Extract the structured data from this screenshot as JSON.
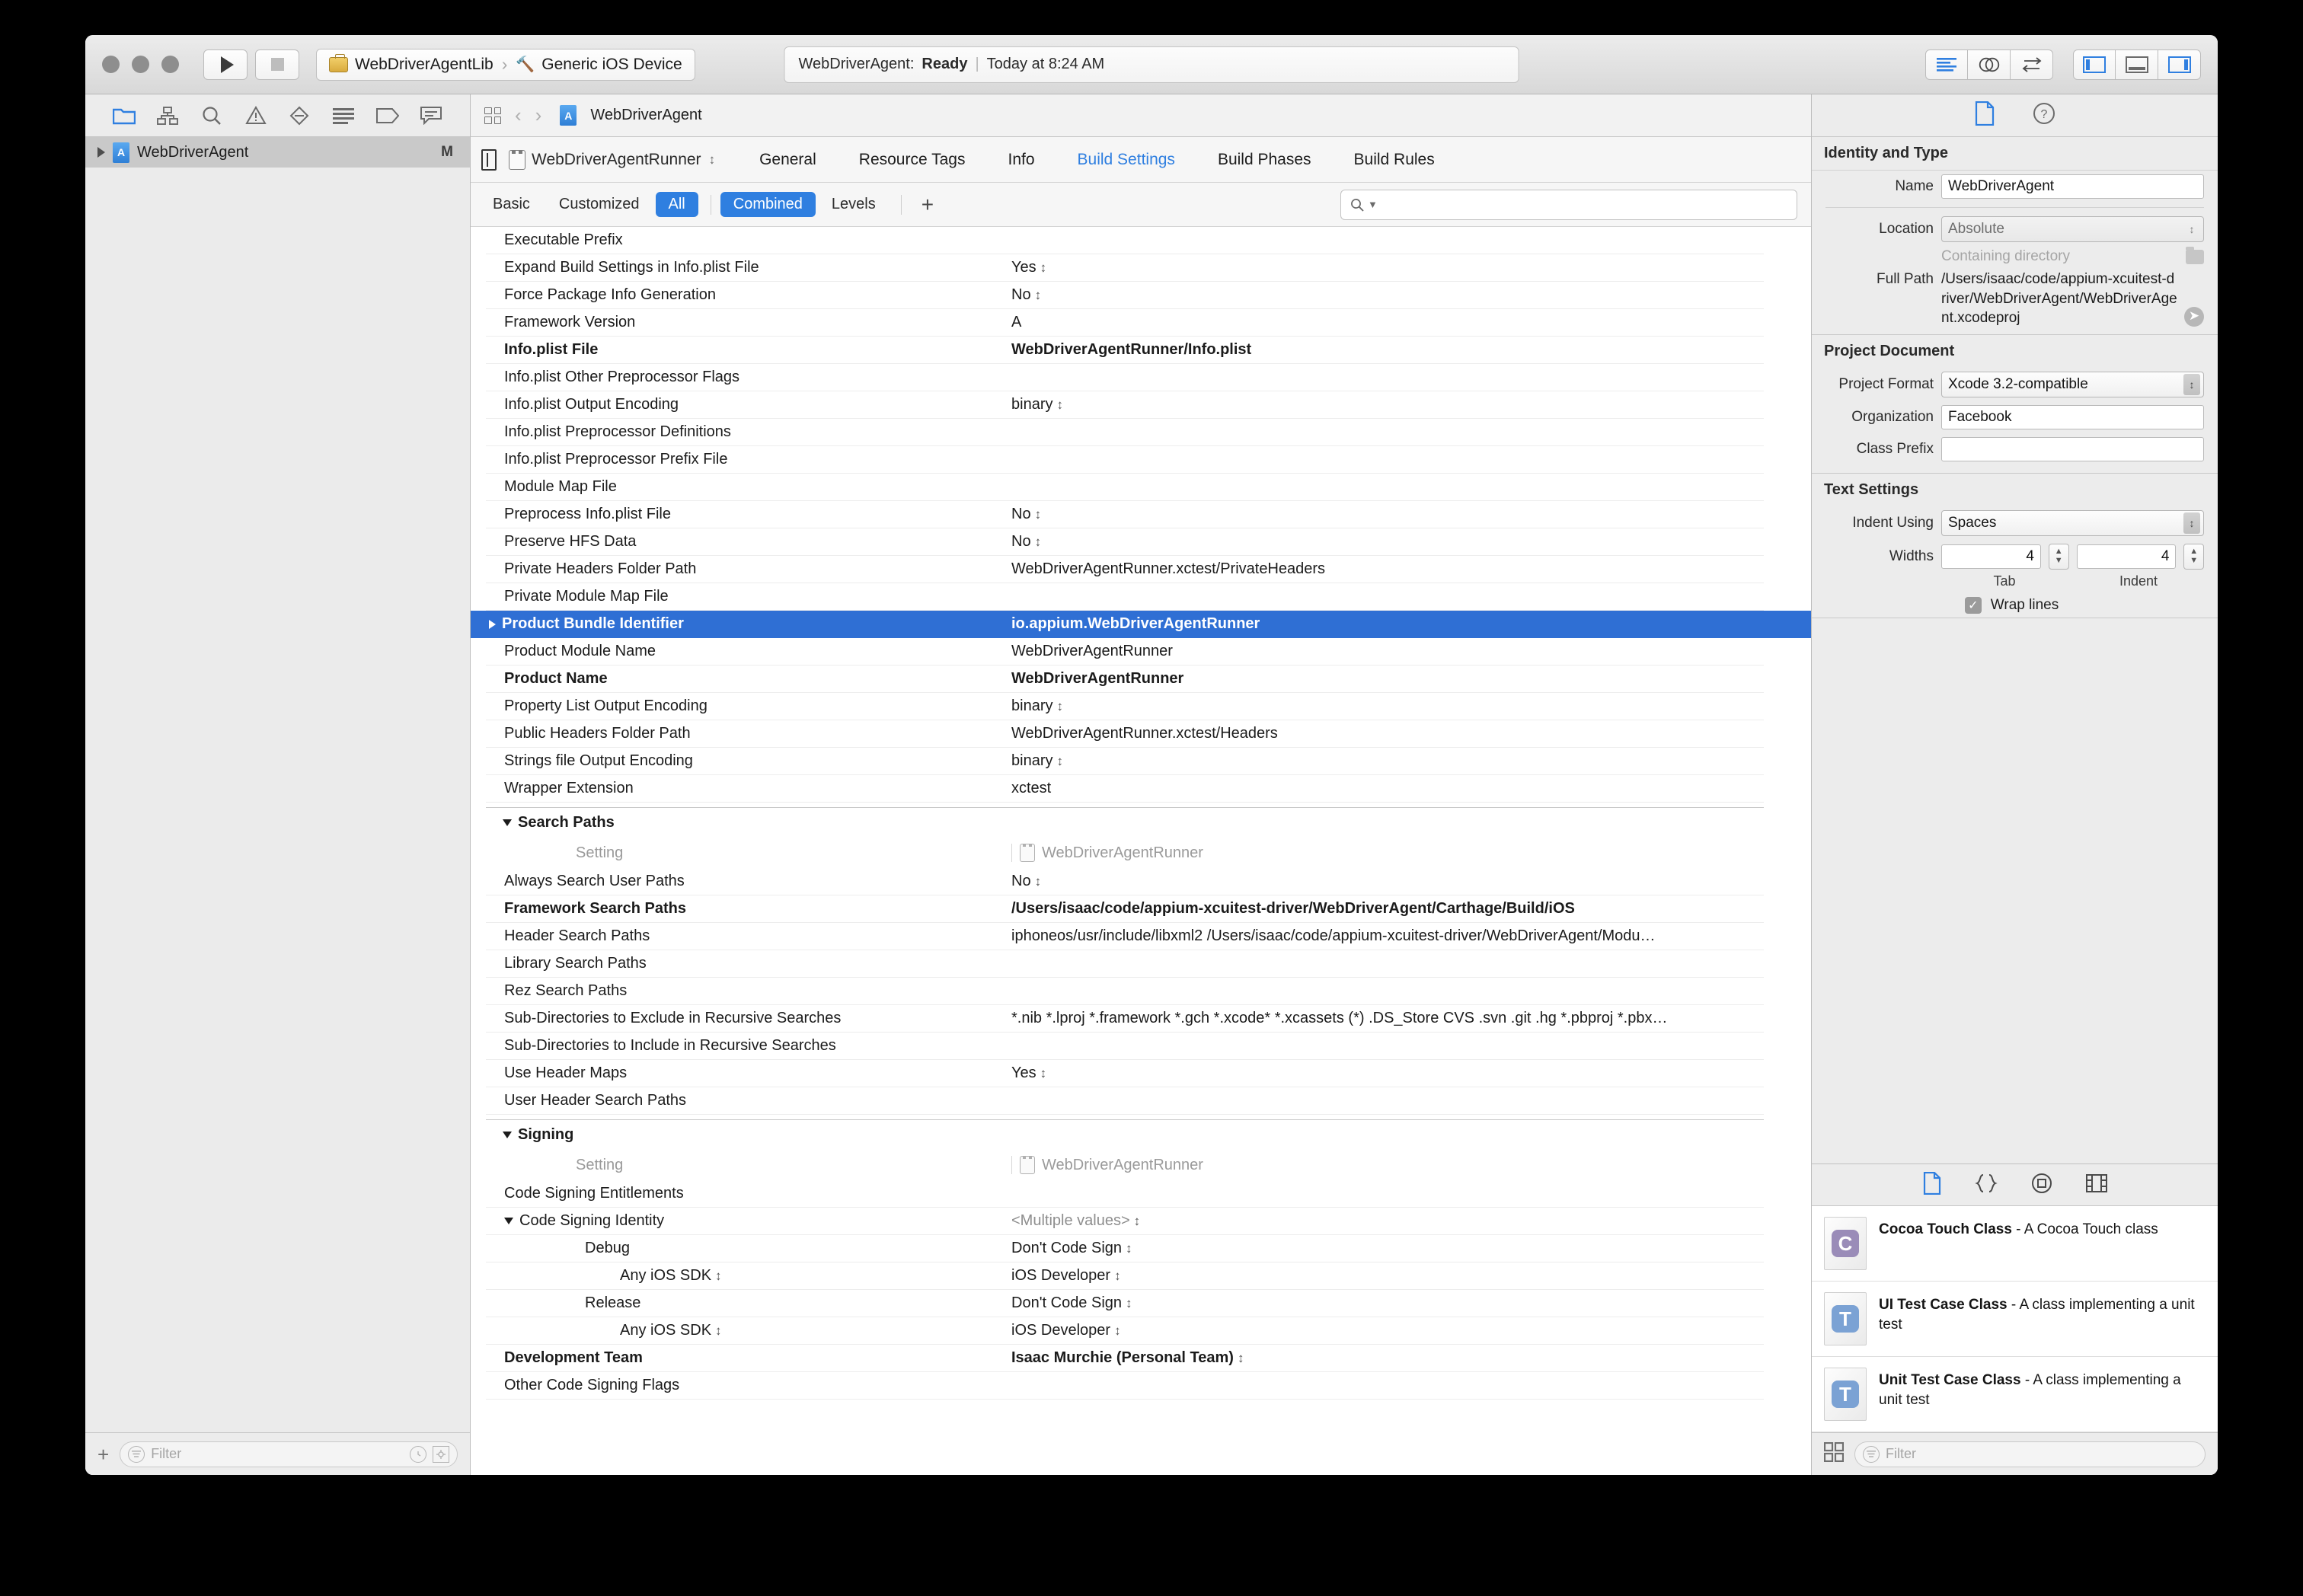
{
  "toolbar": {
    "run_icon": "play-icon",
    "stop_icon": "stop-icon",
    "scheme_name": "WebDriverAgentLib",
    "destination": "Generic iOS Device",
    "status_prefix": "WebDriverAgent:",
    "status_state": "Ready",
    "status_time": "Today at 8:24 AM",
    "right_icons": [
      "standard-editor-icon",
      "assistant-editor-icon",
      "version-editor-icon",
      "navigator-toggle-icon",
      "debug-area-toggle-icon",
      "utilities-toggle-icon"
    ]
  },
  "navigator": {
    "tabs": [
      "project-navigator-icon",
      "source-control-navigator-icon",
      "search-navigator-icon",
      "issue-navigator-icon",
      "test-navigator-icon",
      "debug-navigator-icon",
      "breakpoint-navigator-icon",
      "report-navigator-icon"
    ],
    "project_row": {
      "label": "WebDriverAgent",
      "status": "M"
    },
    "filter_placeholder": "Filter",
    "add_label": "+"
  },
  "jump_bar": {
    "title": "WebDriverAgent"
  },
  "project_editor": {
    "target_name": "WebDriverAgentRunner",
    "tabs": [
      "General",
      "Resource Tags",
      "Info",
      "Build Settings",
      "Build Phases",
      "Build Rules"
    ],
    "active_tab": "Build Settings"
  },
  "filter_bar": {
    "chips": [
      "Basic",
      "Customized",
      "All"
    ],
    "active_chip": "All",
    "mode_chips": [
      "Combined",
      "Levels"
    ],
    "active_mode": "Combined",
    "add_label": "+",
    "search_placeholder": ""
  },
  "settings": {
    "column_setting_header": "Setting",
    "column_target_header": "WebDriverAgentRunner",
    "packaging_rows": [
      {
        "name": "Executable Prefix",
        "value": "",
        "bold": false
      },
      {
        "name": "Expand Build Settings in Info.plist File",
        "value": "Yes",
        "popup": true
      },
      {
        "name": "Force Package Info Generation",
        "value": "No",
        "popup": true
      },
      {
        "name": "Framework Version",
        "value": "A"
      },
      {
        "name": "Info.plist File",
        "value": "WebDriverAgentRunner/Info.plist",
        "bold": true
      },
      {
        "name": "Info.plist Other Preprocessor Flags",
        "value": ""
      },
      {
        "name": "Info.plist Output Encoding",
        "value": "binary",
        "popup": true
      },
      {
        "name": "Info.plist Preprocessor Definitions",
        "value": ""
      },
      {
        "name": "Info.plist Preprocessor Prefix File",
        "value": ""
      },
      {
        "name": "Module Map File",
        "value": ""
      },
      {
        "name": "Preprocess Info.plist File",
        "value": "No",
        "popup": true
      },
      {
        "name": "Preserve HFS Data",
        "value": "No",
        "popup": true
      },
      {
        "name": "Private Headers Folder Path",
        "value": "WebDriverAgentRunner.xctest/PrivateHeaders"
      },
      {
        "name": "Private Module Map File",
        "value": ""
      }
    ],
    "selected_row": {
      "name": "Product Bundle Identifier",
      "value": "io.appium.WebDriverAgentRunner"
    },
    "packaging_rows_after": [
      {
        "name": "Product Module Name",
        "value": "WebDriverAgentRunner"
      },
      {
        "name": "Product Name",
        "value": "WebDriverAgentRunner",
        "bold": true
      },
      {
        "name": "Property List Output Encoding",
        "value": "binary",
        "popup": true
      },
      {
        "name": "Public Headers Folder Path",
        "value": "WebDriverAgentRunner.xctest/Headers"
      },
      {
        "name": "Strings file Output Encoding",
        "value": "binary",
        "popup": true
      },
      {
        "name": "Wrapper Extension",
        "value": "xctest"
      }
    ],
    "search_paths_group": "Search Paths",
    "search_paths_rows": [
      {
        "name": "Always Search User Paths",
        "value": "No",
        "popup": true
      },
      {
        "name": "Framework Search Paths",
        "value": "/Users/isaac/code/appium-xcuitest-driver/WebDriverAgent/Carthage/Build/iOS",
        "bold": true
      },
      {
        "name": "Header Search Paths",
        "value": "iphoneos/usr/include/libxml2 /Users/isaac/code/appium-xcuitest-driver/WebDriverAgent/Modu…"
      },
      {
        "name": "Library Search Paths",
        "value": ""
      },
      {
        "name": "Rez Search Paths",
        "value": ""
      },
      {
        "name": "Sub-Directories to Exclude in Recursive Searches",
        "value": "*.nib *.lproj *.framework *.gch *.xcode* *.xcassets (*) .DS_Store CVS .svn .git .hg *.pbproj *.pbx…"
      },
      {
        "name": "Sub-Directories to Include in Recursive Searches",
        "value": ""
      },
      {
        "name": "Use Header Maps",
        "value": "Yes",
        "popup": true
      },
      {
        "name": "User Header Search Paths",
        "value": ""
      }
    ],
    "signing_group": "Signing",
    "signing_rows": [
      {
        "name": "Code Signing Entitlements",
        "value": "",
        "indent": 0
      },
      {
        "name": "Code Signing Identity",
        "value": "<Multiple values>",
        "popup": true,
        "expanded": true,
        "muted_value": true,
        "indent": 0
      },
      {
        "name": "Debug",
        "value": "Don't Code Sign",
        "popup": true,
        "indent": 1
      },
      {
        "name": "Any iOS SDK",
        "value": "iOS Developer",
        "popup": true,
        "name_popup": true,
        "indent": 2
      },
      {
        "name": "Release",
        "value": "Don't Code Sign",
        "popup": true,
        "indent": 1
      },
      {
        "name": "Any iOS SDK",
        "value": "iOS Developer",
        "popup": true,
        "name_popup": true,
        "indent": 2
      },
      {
        "name": "Development Team",
        "value": "Isaac Murchie (Personal Team)",
        "popup": true,
        "bold": true,
        "indent": 0
      },
      {
        "name": "Other Code Signing Flags",
        "value": "",
        "indent": 0
      }
    ]
  },
  "inspector": {
    "tabs": [
      "file-inspector-icon",
      "quick-help-icon"
    ],
    "identity": {
      "title": "Identity and Type",
      "name_label": "Name",
      "name_value": "WebDriverAgent",
      "location_label": "Location",
      "location_value": "Absolute",
      "containing_directory": "Containing directory",
      "full_path_label": "Full Path",
      "full_path_value": "/Users/isaac/code/appium-xcuitest-driver/WebDriverAgent/WebDriverAgent.xcodeproj"
    },
    "project_document": {
      "title": "Project Document",
      "format_label": "Project Format",
      "format_value": "Xcode 3.2-compatible",
      "organization_label": "Organization",
      "organization_value": "Facebook",
      "class_prefix_label": "Class Prefix",
      "class_prefix_value": ""
    },
    "text_settings": {
      "title": "Text Settings",
      "indent_using_label": "Indent Using",
      "indent_using_value": "Spaces",
      "widths_label": "Widths",
      "tab_value": "4",
      "indent_value": "4",
      "tab_caption": "Tab",
      "indent_caption": "Indent",
      "wrap_lines_label": "Wrap lines",
      "wrap_lines_checked": true
    }
  },
  "library": {
    "tabs": [
      "file-template-library-icon",
      "code-snippet-library-icon",
      "object-library-icon",
      "media-library-icon"
    ],
    "items": [
      {
        "title": "Cocoa Touch Class",
        "desc": " - A Cocoa Touch class",
        "badge": "C",
        "color": "#9a8cb8"
      },
      {
        "title": "UI Test Case Class",
        "desc": " - A class implementing a unit test",
        "badge": "T",
        "color": "#7ba2d4"
      },
      {
        "title": "Unit Test Case Class",
        "desc": " - A class implementing a unit test",
        "badge": "T",
        "color": "#7ba2d4"
      }
    ],
    "filter_placeholder": "Filter"
  },
  "colors": {
    "accent": "#2f7fe0",
    "selection": "#2f6fd4",
    "link": "#2f7fe0"
  }
}
